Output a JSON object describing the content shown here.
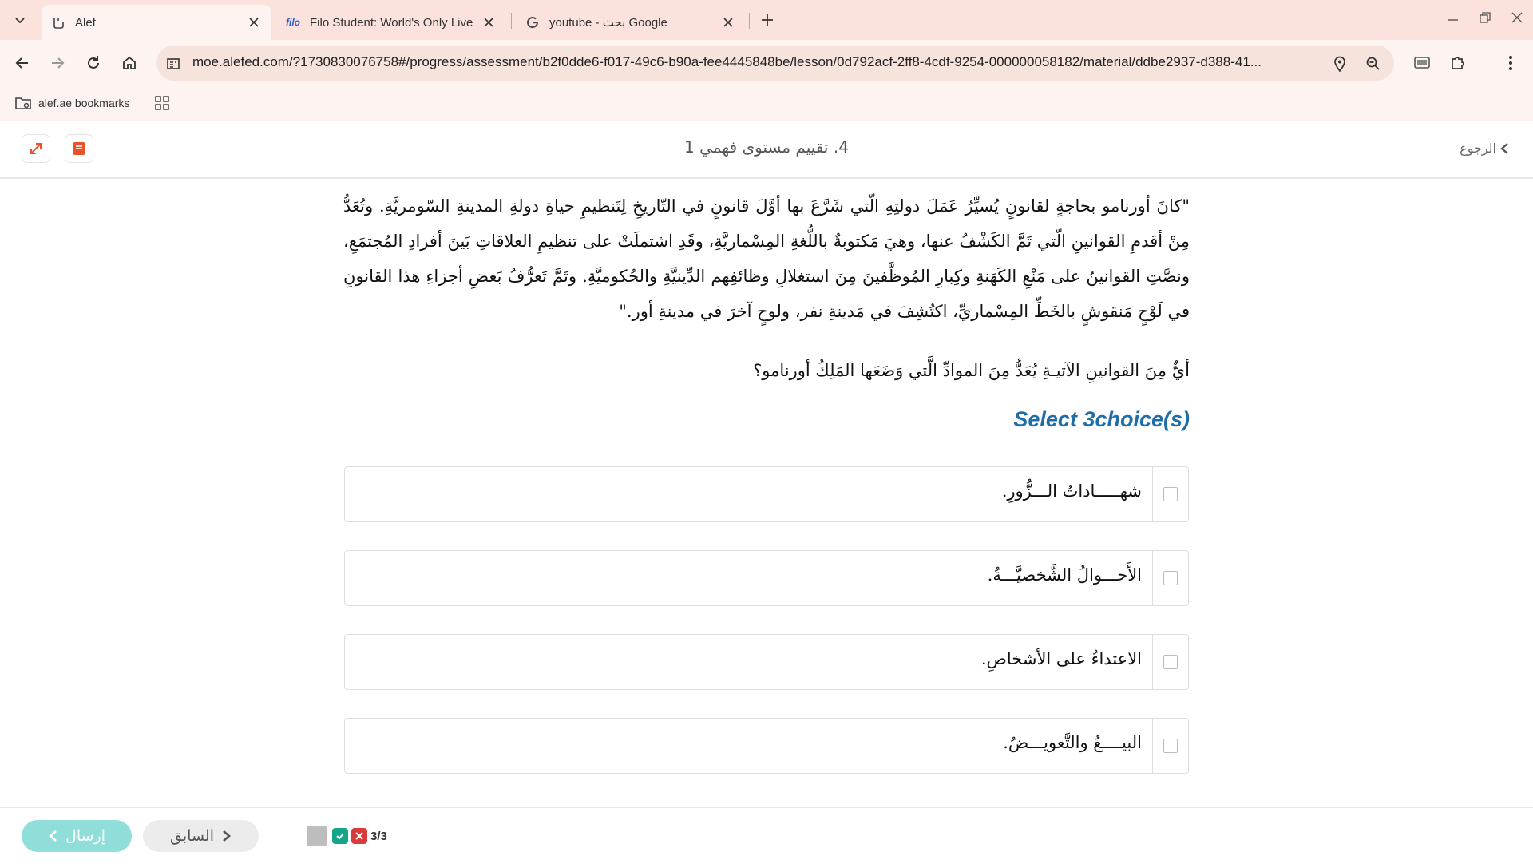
{
  "browser": {
    "tabs": [
      {
        "title": "Alef",
        "active": true
      },
      {
        "title": "Filo Student: World's Only Live I",
        "active": false
      },
      {
        "title": "youtube - بحث Google",
        "active": false
      }
    ],
    "favicon_filo": "filo",
    "url": "moe.alefed.com/?1730830076758#/progress/assessment/b2f0dde6-f017-49c6-b90a-fee4445848be/lesson/0d792acf-2ff8-4cdf-9254-000000058182/material/ddbe2937-d388-41...",
    "bookmarks": [
      {
        "label": "alef.ae bookmarks"
      }
    ]
  },
  "header": {
    "title": "4. تقييم مستوى فهمي 1",
    "back_label": "الرجوع"
  },
  "passage": "\"كانَ أورنامو بحاجةٍ لقانونٍ يُسيِّرُ عَمَلَ دولتِهِ الّتي شَرَّعَ بها أوَّلَ قانونٍ في التّاريخِ لِتَنظيمِ حياةِ دولةِ المدينةِ السّومريَّةِ. وتُعَدُّ مِنْ أقدمِ القوانينِ الّتي تَمَّ الكَشْفُ عنها، وهيَ مَكتوبةٌ باللُّغةِ المِسْماريَّةِ، وقَدِ اشتملَتْ على تنظيمِ العلاقاتِ بَينَ أفرادِ المُجتمَعِ، ونصَّتِ القوانينُ على مَنْعِ الكَهَنةِ وكِبارِ المُوظَّفينَ مِنَ استغلالِ وظائفِهم الدِّينيَّةِ والحُكوميَّةِ. وتَمَّ تَعرُّفُ بَعضِ أجزاءِ هذا القانونِ في لَوْحٍ مَنقوشٍ بالخَطِّ المِسْماريِّ، اكتُشِفَ في مَدينةِ نفر، ولوحٍ آخرَ في مدينةِ أور.\"",
  "question": "أيٌّ مِنَ القوانينِ الآتيـةِ يُعَدُّ مِنَ الموادِّ الَّتي وَضَعَها المَلِكُ أورنامو؟",
  "select_hint": "Select 3choice(s)",
  "options": [
    {
      "text": "شهـــــاداتُ الـــزُّورِ."
    },
    {
      "text": "الأَحـــوالُ الشَّخصيَّـــةُ."
    },
    {
      "text": "الاعتداءُ على الأشخاصِ."
    },
    {
      "text": "البيــــعُ والتَّعويـــضُ."
    }
  ],
  "footer": {
    "submit_label": "إرسال",
    "prev_label": "السابق",
    "progress": "3/3"
  },
  "colors": {
    "accent_blue": "#1f6ea8",
    "submit_bg": "#8fded9",
    "correct": "#17a589",
    "wrong": "#d93b3b",
    "tabstrip": "#fbe2dc"
  }
}
